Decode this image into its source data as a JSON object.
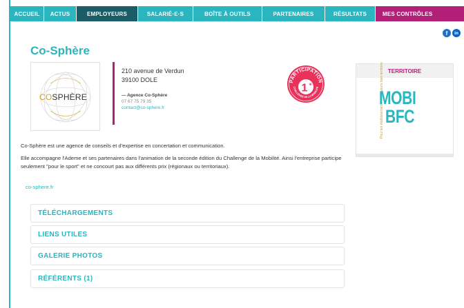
{
  "nav": {
    "items": [
      "ACCUEIL",
      "ACTUS",
      "EMPLOYEURS",
      "SALARIÉ·E·S",
      "BOÎTE À OUTILS",
      "PARTENAIRES",
      "RÉSULTATS",
      "MES CONTRÔLES"
    ],
    "active": "EMPLOYEURS"
  },
  "social": {
    "facebook": "f",
    "linkedin": "in"
  },
  "page_title": "Co-Sphère",
  "logo": {
    "part1": "CO",
    "part2": "SPHÈRE"
  },
  "address": {
    "street": "210 avenue de Verdun",
    "city": "39100 DOLE",
    "agency": "— Agence Co-Sphère",
    "phone": "07 67 75 79 35",
    "email": "contact@co-sphere.fr"
  },
  "badge": {
    "top": "PARTICIPATION",
    "bottom": "CHALLENGE DE LA MOBILITÉ",
    "rank": "1",
    "sup": "e"
  },
  "territory": {
    "heading": "TERRITOIRE",
    "logo_line1": "MOBI",
    "logo_line2": "BFC",
    "logo_side": "Pour les établissements employeurs bien territoire"
  },
  "description": {
    "p1": "Co-Sphère est une agence de conseils et d'expertise en concertation et communication.",
    "p2": "Elle accompagne l'Ademe et ses partenaires dans l'animation de la seconde édition du Challenge de la Mobilité. Ainsi l'entreprise participe seulement \"pour le sport\" et ne concourt pas aux différents prix (régionaux ou territoriaux).",
    "website": "co-sphere.fr"
  },
  "accordions": [
    "TÉLÉCHARGEMENTS",
    "LIENS UTILES",
    "GALERIE PHOTOS",
    "RÉFÉRENTS (1)"
  ],
  "colors": {
    "teal": "#2ab5bf",
    "dark_teal": "#1b5d67",
    "magenta": "#b21f76",
    "badge": "#e8315b"
  }
}
